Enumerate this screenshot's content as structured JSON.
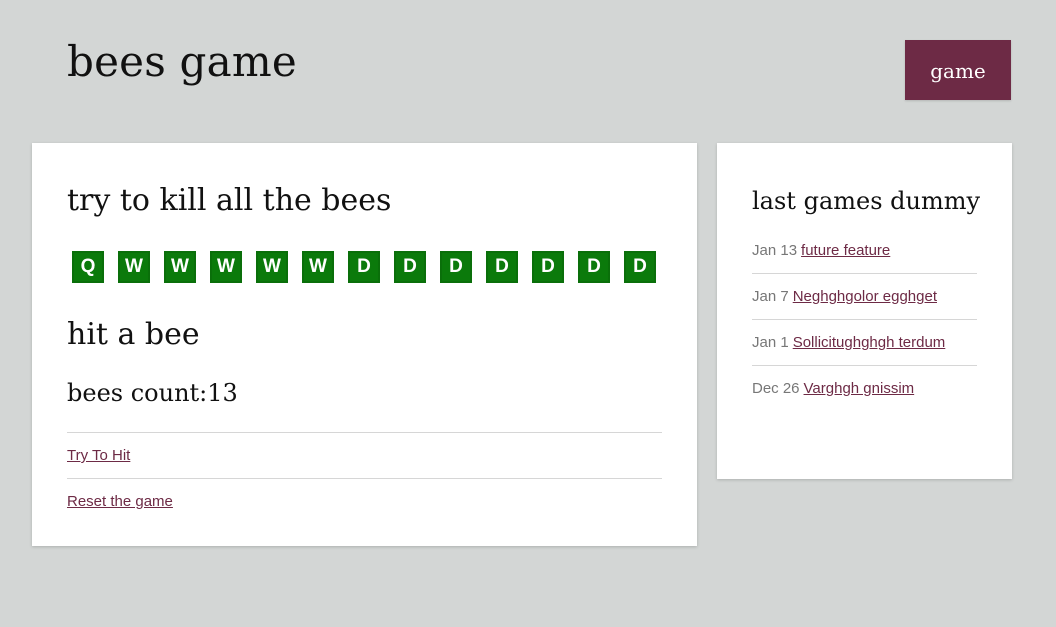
{
  "header": {
    "site_title": "bees game",
    "nav_button_label": "game"
  },
  "main": {
    "title": "try to kill all the bees",
    "keys": [
      "Q",
      "W",
      "W",
      "W",
      "W",
      "W",
      "D",
      "D",
      "D",
      "D",
      "D",
      "D",
      "D"
    ],
    "hit_title": "hit a bee",
    "bees_count_text": "bees count:13",
    "actions": [
      {
        "label": "Try To Hit"
      },
      {
        "label": "Reset the game"
      }
    ]
  },
  "sidebar": {
    "title": "last games dummy",
    "games": [
      {
        "date": "Jan 13",
        "title": "future feature"
      },
      {
        "date": "Jan 7",
        "title": "Neghghgolor egghget"
      },
      {
        "date": "Jan 1",
        "title": "Sollicitughghgh terdum"
      },
      {
        "date": "Dec 26",
        "title": "Varghgh gnissim"
      }
    ]
  },
  "colors": {
    "accent": "#6d2a45",
    "bee_tile": "#0b7a0b",
    "background": "#d3d6d5"
  }
}
